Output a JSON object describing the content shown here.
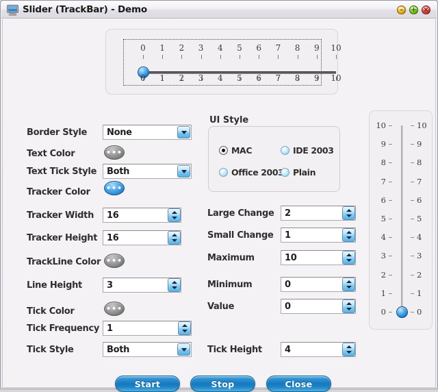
{
  "window": {
    "title": "Slider (TrackBar) - Demo",
    "icon": "monitor-icon",
    "controls": {
      "minimize": "–",
      "maximize": "+",
      "close": "×"
    }
  },
  "horizontal_slider": {
    "name": "horizontal-trackbar",
    "min": 0,
    "max": 10,
    "value": 0,
    "tick_frequency": 1,
    "tick_style": "Both",
    "top_ticks": [
      "0",
      "1",
      "2",
      "3",
      "4",
      "5",
      "6",
      "7",
      "8",
      "9",
      "10"
    ],
    "bottom_ticks": [
      "0",
      "1",
      "2",
      "3",
      "4",
      "5",
      "6",
      "7",
      "8",
      "9",
      "10"
    ]
  },
  "vertical_slider": {
    "name": "vertical-trackbar",
    "min": 0,
    "max": 10,
    "value": 0,
    "left_ticks": [
      "10",
      "9",
      "8",
      "7",
      "6",
      "5",
      "4",
      "3",
      "2",
      "1",
      "0"
    ],
    "right_ticks": [
      "10",
      "9",
      "8",
      "7",
      "6",
      "5",
      "4",
      "3",
      "2",
      "1",
      "0"
    ]
  },
  "left_fields": {
    "border_style": {
      "label": "Border Style",
      "value": "None",
      "type": "combo"
    },
    "text_color": {
      "label": "Text Color",
      "value": "•••",
      "swatch": "#7a7a7a",
      "type": "color"
    },
    "text_tick_style": {
      "label": "Text Tick Style",
      "value": "Both",
      "type": "combo"
    },
    "tracker_color": {
      "label": "Tracker Color",
      "value": "•••",
      "swatch": "#2f95db",
      "type": "color"
    },
    "tracker_width": {
      "label": "Tracker Width",
      "value": "16",
      "type": "spin"
    },
    "tracker_height": {
      "label": "Tracker Height",
      "value": "16",
      "type": "spin"
    },
    "trackline_color": {
      "label": "TrackLine Color",
      "value": "•••",
      "swatch": "#7a7a7a",
      "type": "color"
    },
    "line_height": {
      "label": "Line Height",
      "value": "3",
      "type": "spin"
    },
    "tick_color": {
      "label": "Tick Color",
      "value": "•••",
      "swatch": "#9a9a9a",
      "type": "color"
    },
    "tick_frequency": {
      "label": "Tick Frequency",
      "value": "1",
      "type": "spin"
    },
    "tick_style": {
      "label": "Tick Style",
      "value": "Both",
      "type": "combo"
    }
  },
  "ui_style": {
    "title": "UI Style",
    "options": [
      {
        "label": "MAC",
        "checked": true
      },
      {
        "label": "IDE 2003",
        "checked": false
      },
      {
        "label": "Office 2003",
        "checked": false
      },
      {
        "label": "Plain",
        "checked": false
      }
    ]
  },
  "right_fields": {
    "large_change": {
      "label": "Large Change",
      "value": "2"
    },
    "small_change": {
      "label": "Small Change",
      "value": "1"
    },
    "maximum": {
      "label": "Maximum",
      "value": "10"
    },
    "minimum": {
      "label": "Minimum",
      "value": "0"
    },
    "value": {
      "label": "Value",
      "value": "0"
    },
    "tick_height": {
      "label": "Tick Height",
      "value": "4"
    }
  },
  "buttons": {
    "start": "Start",
    "stop": "Stop",
    "close": "Close"
  },
  "colors": {
    "accent": "#1878bf",
    "thumb": "#2f95db",
    "window_bg": "#f5f2f5",
    "panel_bg": "#f2eff2"
  }
}
